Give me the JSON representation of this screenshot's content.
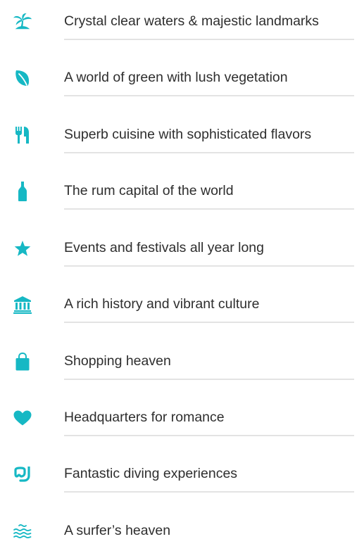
{
  "accent_color": "#16b8c4",
  "features": [
    {
      "icon": "palm-island-icon",
      "label": "Crystal clear waters & majestic landmarks"
    },
    {
      "icon": "leaf-icon",
      "label": "A world of green with lush vegetation"
    },
    {
      "icon": "fork-knife-icon",
      "label": "Superb cuisine with sophisticated flavors"
    },
    {
      "icon": "bottle-icon",
      "label": "The rum capital of the world"
    },
    {
      "icon": "star-icon",
      "label": "Events and festivals all year long"
    },
    {
      "icon": "museum-icon",
      "label": "A rich history and vibrant culture"
    },
    {
      "icon": "shopping-bag-icon",
      "label": "Shopping heaven"
    },
    {
      "icon": "heart-icon",
      "label": "Headquarters for romance"
    },
    {
      "icon": "snorkel-mask-icon",
      "label": "Fantastic diving experiences"
    },
    {
      "icon": "waves-icon",
      "label": "A surfer’s heaven"
    }
  ]
}
